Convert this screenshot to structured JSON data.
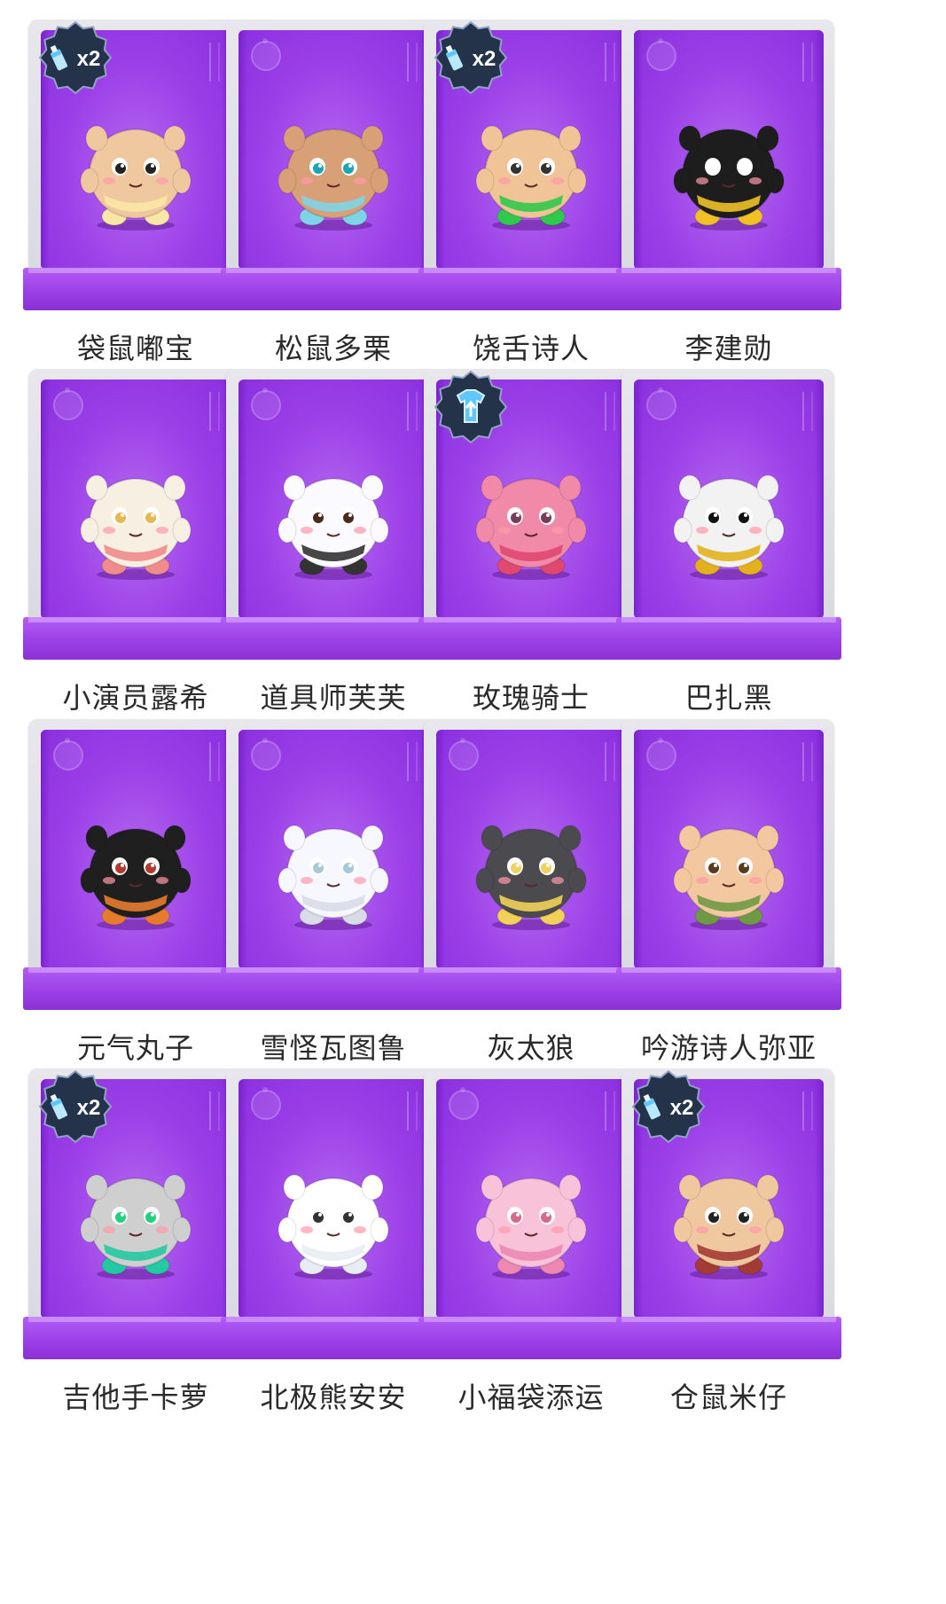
{
  "characters": [
    {
      "name": "袋鼠嘟宝",
      "body": "#f0c8a0",
      "accent": "#f9e7a6",
      "eye": "#222222",
      "badge": "x2"
    },
    {
      "name": "松鼠多栗",
      "body": "#d8a077",
      "accent": "#7fd3e6",
      "eye": "#1aa6b4",
      "badge": ""
    },
    {
      "name": "饶舌诗人",
      "body": "#f0c497",
      "accent": "#2fc94b",
      "eye": "#333333",
      "badge": "x2"
    },
    {
      "name": "李建勋",
      "body": "#1d1d1d",
      "accent": "#f0c126",
      "eye": "#ffffff",
      "badge": ""
    },
    {
      "name": "小演员露希",
      "body": "#f6efe2",
      "accent": "#f08b8b",
      "eye": "#e6b84d",
      "badge": ""
    },
    {
      "name": "道具师芙芙",
      "body": "#fbfbff",
      "accent": "#333333",
      "eye": "#4b2a1c",
      "badge": ""
    },
    {
      "name": "玫瑰骑士",
      "body": "#f08aa8",
      "accent": "#e04870",
      "eye": "#7b3c5a",
      "badge": "shirt"
    },
    {
      "name": "巴扎黑",
      "body": "#f2f2f2",
      "accent": "#e3b11e",
      "eye": "#111111",
      "badge": ""
    },
    {
      "name": "元气丸子",
      "body": "#1f1f1f",
      "accent": "#e77b2d",
      "eye": "#b23b2d",
      "badge": ""
    },
    {
      "name": "雪怪瓦图鲁",
      "body": "#f7f7ff",
      "accent": "#d8dce8",
      "eye": "#a6c8d8",
      "badge": ""
    },
    {
      "name": "灰太狼",
      "body": "#4a4a4f",
      "accent": "#f2d159",
      "eye": "#f0d060",
      "badge": ""
    },
    {
      "name": "吟游诗人弥亚",
      "body": "#f3c7a0",
      "accent": "#6f9a45",
      "eye": "#5a3b1c",
      "badge": ""
    },
    {
      "name": "吉他手卡萝",
      "body": "#cfcfcf",
      "accent": "#23c9a0",
      "eye": "#25d07b",
      "badge": "x2"
    },
    {
      "name": "北极熊安安",
      "body": "#ffffff",
      "accent": "#e8ecf4",
      "eye": "#333333",
      "badge": ""
    },
    {
      "name": "小福袋添运",
      "body": "#f8c2d8",
      "accent": "#ec88b2",
      "eye": "#d46a8e",
      "badge": ""
    },
    {
      "name": "仓鼠米仔",
      "body": "#f0c8a0",
      "accent": "#a23b35",
      "eye": "#222222",
      "badge": "x2"
    }
  ],
  "badges": {
    "x2_text": "x2"
  },
  "colors": {
    "card_purple": "#9b3fe8",
    "base_purple": "#a04ae9",
    "frame_gray": "#e2e2e8",
    "badge_dark": "#24324a",
    "badge_blue": "#5fc6ff"
  }
}
